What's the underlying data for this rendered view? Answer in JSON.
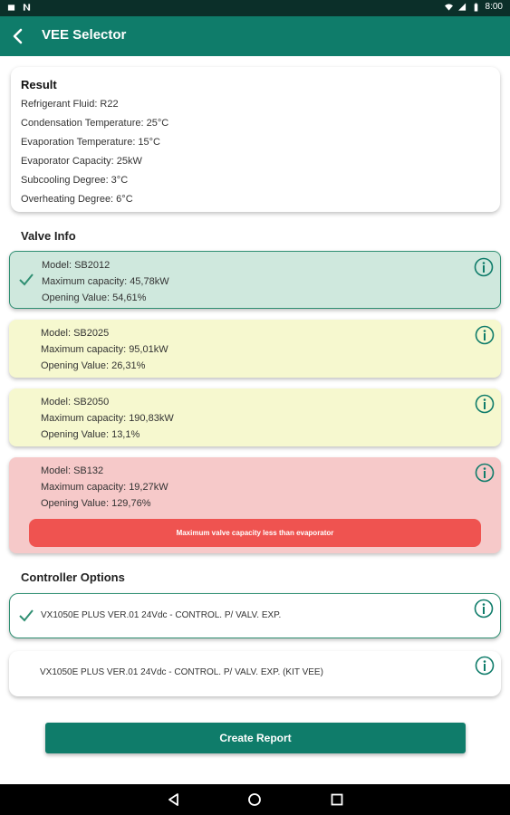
{
  "status_bar": {
    "time": "8:00"
  },
  "app_bar": {
    "title": "VEE Selector"
  },
  "result": {
    "title": "Result",
    "lines": [
      "Refrigerant Fluid: R22",
      "Condensation Temperature: 25°C",
      "Evaporation Temperature: 15°C",
      "Evaporator Capacity: 25kW",
      "Subcooling Degree: 3°C",
      "Overheating Degree: 6°C"
    ]
  },
  "valve_info": {
    "label": "Valve Info",
    "items": [
      {
        "model": "Model: SB2012",
        "capacity": "Maximum capacity: 45,78kW",
        "opening": "Opening Value: 54,61%",
        "status": "selected",
        "color": "#cfe8dd"
      },
      {
        "model": "Model: SB2025",
        "capacity": "Maximum capacity: 95,01kW",
        "opening": "Opening Value: 26,31%",
        "status": "ok",
        "color": "#f6f8cf"
      },
      {
        "model": "Model: SB2050",
        "capacity": "Maximum capacity: 190,83kW",
        "opening": "Opening Value: 13,1%",
        "status": "ok",
        "color": "#f6f8cf"
      },
      {
        "model": "Model: SB132",
        "capacity": "Maximum capacity: 19,27kW",
        "opening": "Opening Value: 129,76%",
        "status": "error",
        "color": "#f6c9c9",
        "warning": "Maximum valve capacity less than evaporator"
      }
    ]
  },
  "controller_options": {
    "label": "Controller Options",
    "items": [
      {
        "label": "VX1050E PLUS VER.01 24Vdc - CONTROL. P/ VALV. EXP.",
        "selected": true
      },
      {
        "label": "VX1050E PLUS VER.01 24Vdc - CONTROL. P/ VALV. EXP. (KIT VEE)",
        "selected": false
      }
    ]
  },
  "create_report_label": "Create Report",
  "colors": {
    "primary": "#0f7c6a",
    "status_bar": "#0b2f29",
    "error": "#ef5350",
    "selected_border": "#2f8f72"
  },
  "icons": [
    "back-arrow-icon",
    "check-icon",
    "info-icon",
    "nav-back-icon",
    "nav-home-icon",
    "nav-recents-icon"
  ]
}
